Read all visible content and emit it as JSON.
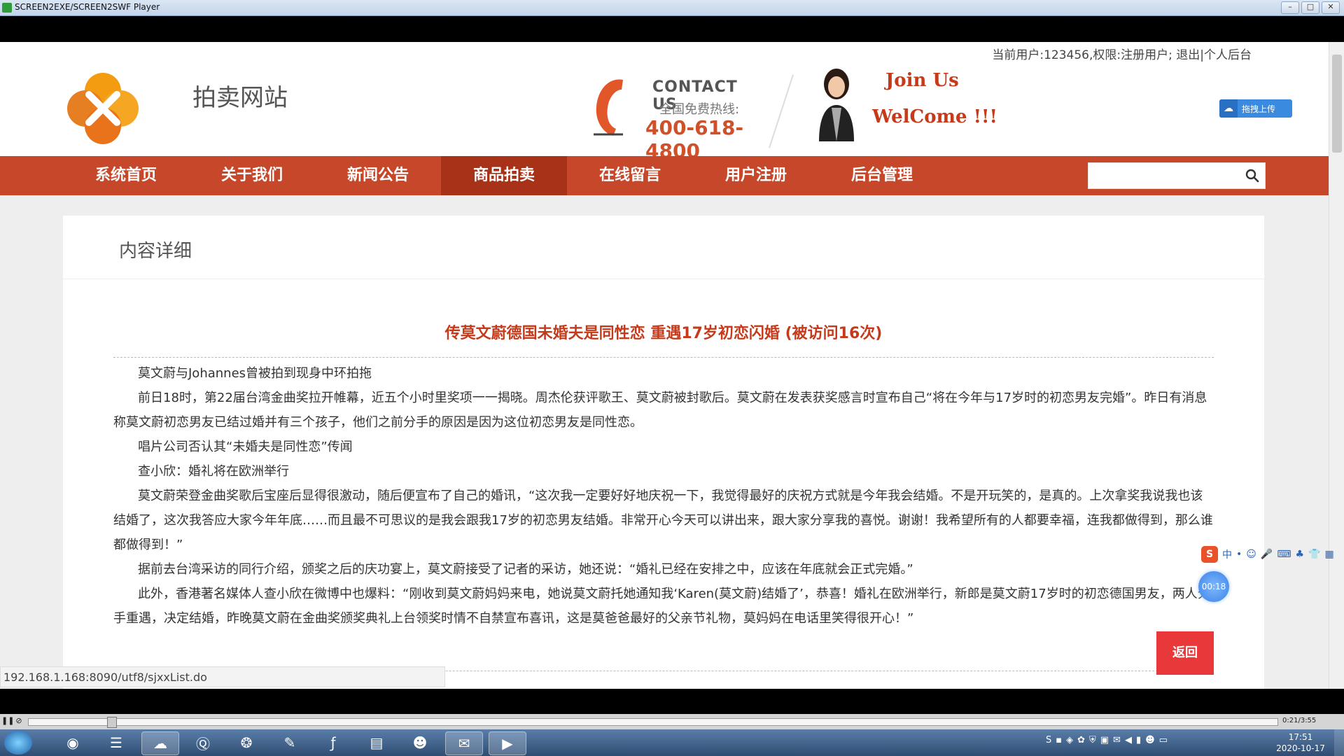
{
  "window": {
    "title": "SCREEN2EXE/SCREEN2SWF Player",
    "buttons": [
      "–",
      "□",
      "✕"
    ]
  },
  "header": {
    "user_info": "当前用户:123456,权限:注册用户; 退出|个人后台",
    "site_name": "拍卖网站",
    "contact_title": "CONTACT US",
    "contact_sub": "全国免费热线:",
    "contact_phone": "400-618-4800",
    "join_text": "Join Us",
    "welcome_text": "WelCome !!!",
    "upload_label": "拖拽上传"
  },
  "nav": {
    "items": [
      {
        "label": "系统首页"
      },
      {
        "label": "关于我们"
      },
      {
        "label": "新闻公告"
      },
      {
        "label": "商品拍卖"
      },
      {
        "label": "在线留言"
      },
      {
        "label": "用户注册"
      },
      {
        "label": "后台管理"
      }
    ],
    "active_index": 3,
    "search_placeholder": ""
  },
  "content": {
    "section_title": "内容详细",
    "article_title": "传莫文蔚德国未婚夫是同性恋 重遇17岁初恋闪婚 (被访问16次)",
    "paragraphs": [
      "莫文蔚与Johannes曾被拍到现身中环拍拖",
      "前日18时，第22届台湾金曲奖拉开帷幕，近五个小时里奖项一一揭晓。周杰伦获评歌王、莫文蔚被封歌后。莫文蔚在发表获奖感言时宣布自己“将在今年与17岁时的初恋男友完婚”。昨日有消息称莫文蔚初恋男友已结过婚并有三个孩子，他们之前分手的原因是因为这位初恋男友是同性恋。",
      "唱片公司否认其“未婚夫是同性恋”传闻",
      "查小欣：婚礼将在欧洲举行",
      "莫文蔚荣登金曲奖歌后宝座后显得很激动，随后便宣布了自己的婚讯，“这次我一定要好好地庆祝一下，我觉得最好的庆祝方式就是今年我会结婚。不是开玩笑的，是真的。上次拿奖我说我也该结婚了，这次我答应大家今年年底……而且最不可思议的是我会跟我17岁的初恋男友结婚。非常开心今天可以讲出来，跟大家分享我的喜悦。谢谢！我希望所有的人都要幸福，连我都做得到，那么谁都做得到！”",
      "据前去台湾采访的同行介绍，颁奖之后的庆功宴上，莫文蔚接受了记者的采访，她还说：“婚礼已经在安排之中，应该在年底就会正式完婚。”",
      "此外，香港著名媒体人查小欣在微博中也爆料：“刚收到莫文蔚妈妈来电，她说莫文蔚托她通知我‘Karen(莫文蔚)结婚了’，恭喜！婚礼在欧洲举行，新郎是莫文蔚17岁时的初恋德国男友，两人分手重遇，决定结婚，昨晚莫文蔚在金曲奖颁奖典礼上台领奖时情不自禁宣布喜讯，这是莫爸爸最好的父亲节礼物，莫妈妈在电话里笑得很开心！”"
    ],
    "back_label": "返回"
  },
  "status_url": "192.168.1.168:8090/utf8/sjxxList.do",
  "overlay": {
    "ime_items": [
      "S",
      "中",
      "•",
      "☺",
      "🎤",
      "⌨",
      "♣",
      "👕",
      "▦"
    ],
    "timer": "00:18"
  },
  "player": {
    "time": "0:21/3:55",
    "progress": 0.063
  },
  "taskbar": {
    "apps": [
      "chrome",
      "notepad",
      "baidu",
      "qq-browser",
      "360",
      "notepad++",
      "flash",
      "explorer",
      "qq",
      "wechat",
      "screen2swf"
    ],
    "clock_time": "17:51",
    "clock_date": "2020-10-17"
  }
}
